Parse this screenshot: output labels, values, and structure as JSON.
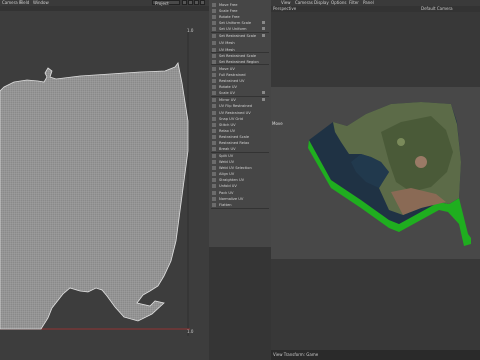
{
  "left_menu": {
    "items": [
      "Camera Fr",
      "Field",
      "Window"
    ]
  },
  "uv_editor": {
    "mode_dropdown": "Project",
    "axis_top_right": "1.0",
    "axis_bottom_right": "1.0"
  },
  "tool_panel": {
    "items": [
      "Move Free",
      "Scale Free",
      "Rotate Free",
      "Set Uniform Scale",
      "Set UV Uniform",
      "Set Restrained Scale",
      "UV Mesh",
      "UV Mesh",
      "Set Restrained Scale",
      "Set Restrained Region",
      "Move UV",
      "Full Restrained",
      "Restrained UV",
      "Rotate UV",
      "Scale UV",
      "Mirror UV",
      "UV Flip Restrained",
      "UV Restrained UV",
      "Snap UV Grid",
      "Stitch UV",
      "Relax UV",
      "Restrained Scale",
      "Restrained Relax",
      "Break UV",
      "Split UV",
      "Weld UV",
      "Weld UV Selection",
      "Align UV",
      "Straighten UV",
      "Unfold UV",
      "Pack UV",
      "Normalize UV",
      "Flatten"
    ]
  },
  "right_menu": {
    "items": [
      "View",
      "Cameras",
      "Display",
      "Options",
      "Filter",
      "Panel"
    ]
  },
  "viewport": {
    "view_label": "Perspective",
    "camera_label": "Default Camera",
    "hud_label": "Move",
    "status_text": "View Transform: Game"
  },
  "colors": {
    "accent_uv_edge": "#e0e0e0",
    "terrain_side": "#1fae1f",
    "sea": "#1f3244",
    "land": "#5c6b48"
  }
}
